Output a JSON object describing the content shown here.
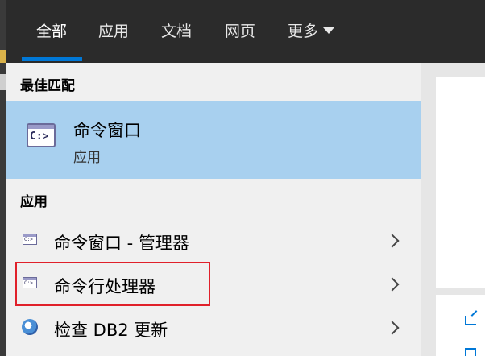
{
  "tabs": [
    {
      "label": "全部",
      "active": true
    },
    {
      "label": "应用"
    },
    {
      "label": "文档"
    },
    {
      "label": "网页"
    },
    {
      "label": "更多"
    }
  ],
  "best_match": {
    "heading": "最佳匹配",
    "title": "命令窗口",
    "subtitle": "应用",
    "icon": "cmd-icon"
  },
  "apps": {
    "heading": "应用",
    "items": [
      {
        "label": "命令窗口 - 管理器",
        "icon": "cmd-icon"
      },
      {
        "label": "命令行处理器",
        "icon": "cmd-icon",
        "highlighted": true
      },
      {
        "label": "检查 DB2 更新",
        "icon": "db2-globe-icon"
      }
    ]
  },
  "icon_glyphs": {
    "cmd_big": "C:>",
    "cmd_small": "C:>"
  },
  "colors": {
    "accent": "#0078d7",
    "selection": "#a8d0ef",
    "highlight_box": "#e0202a",
    "topbar": "#2b2b2b"
  }
}
